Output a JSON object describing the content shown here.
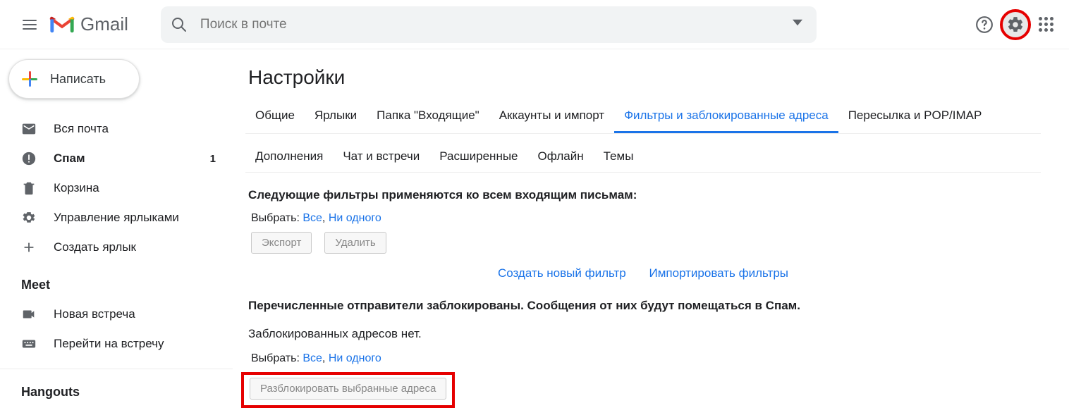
{
  "header": {
    "product": "Gmail",
    "search_placeholder": "Поиск в почте"
  },
  "compose_label": "Написать",
  "sidebar": {
    "items": [
      {
        "label": "Вся почта",
        "icon": "mail",
        "bold": false,
        "count": ""
      },
      {
        "label": "Спам",
        "icon": "spam",
        "bold": true,
        "count": "1"
      },
      {
        "label": "Корзина",
        "icon": "trash",
        "bold": false,
        "count": ""
      },
      {
        "label": "Управление ярлыками",
        "icon": "gear",
        "bold": false,
        "count": ""
      },
      {
        "label": "Создать ярлык",
        "icon": "plus",
        "bold": false,
        "count": ""
      }
    ],
    "meet_title": "Meet",
    "meet_items": [
      {
        "label": "Новая встреча",
        "icon": "cam"
      },
      {
        "label": "Перейти на встречу",
        "icon": "keyb"
      }
    ],
    "hangouts_title": "Hangouts"
  },
  "settings": {
    "title": "Настройки",
    "tabs_row1": [
      "Общие",
      "Ярлыки",
      "Папка \"Входящие\"",
      "Аккаунты и импорт",
      "Фильтры и заблокированные адреса",
      "Пересылка и POP/IMAP"
    ],
    "tabs_row2": [
      "Дополнения",
      "Чат и встречи",
      "Расширенные",
      "Офлайн",
      "Темы"
    ],
    "active_tab_index": 4,
    "filters_heading": "Следующие фильтры применяются ко всем входящим письмам:",
    "select_label": "Выбрать:",
    "select_all": "Все",
    "select_none": "Ни одного",
    "export_btn": "Экспорт",
    "delete_btn": "Удалить",
    "create_filter": "Создать новый фильтр",
    "import_filters": "Импортировать фильтры",
    "blocked_heading": "Перечисленные отправители заблокированы. Сообщения от них будут помещаться в Спам.",
    "no_blocked": "Заблокированных адресов нет.",
    "unblock_btn": "Разблокировать выбранные адреса"
  }
}
